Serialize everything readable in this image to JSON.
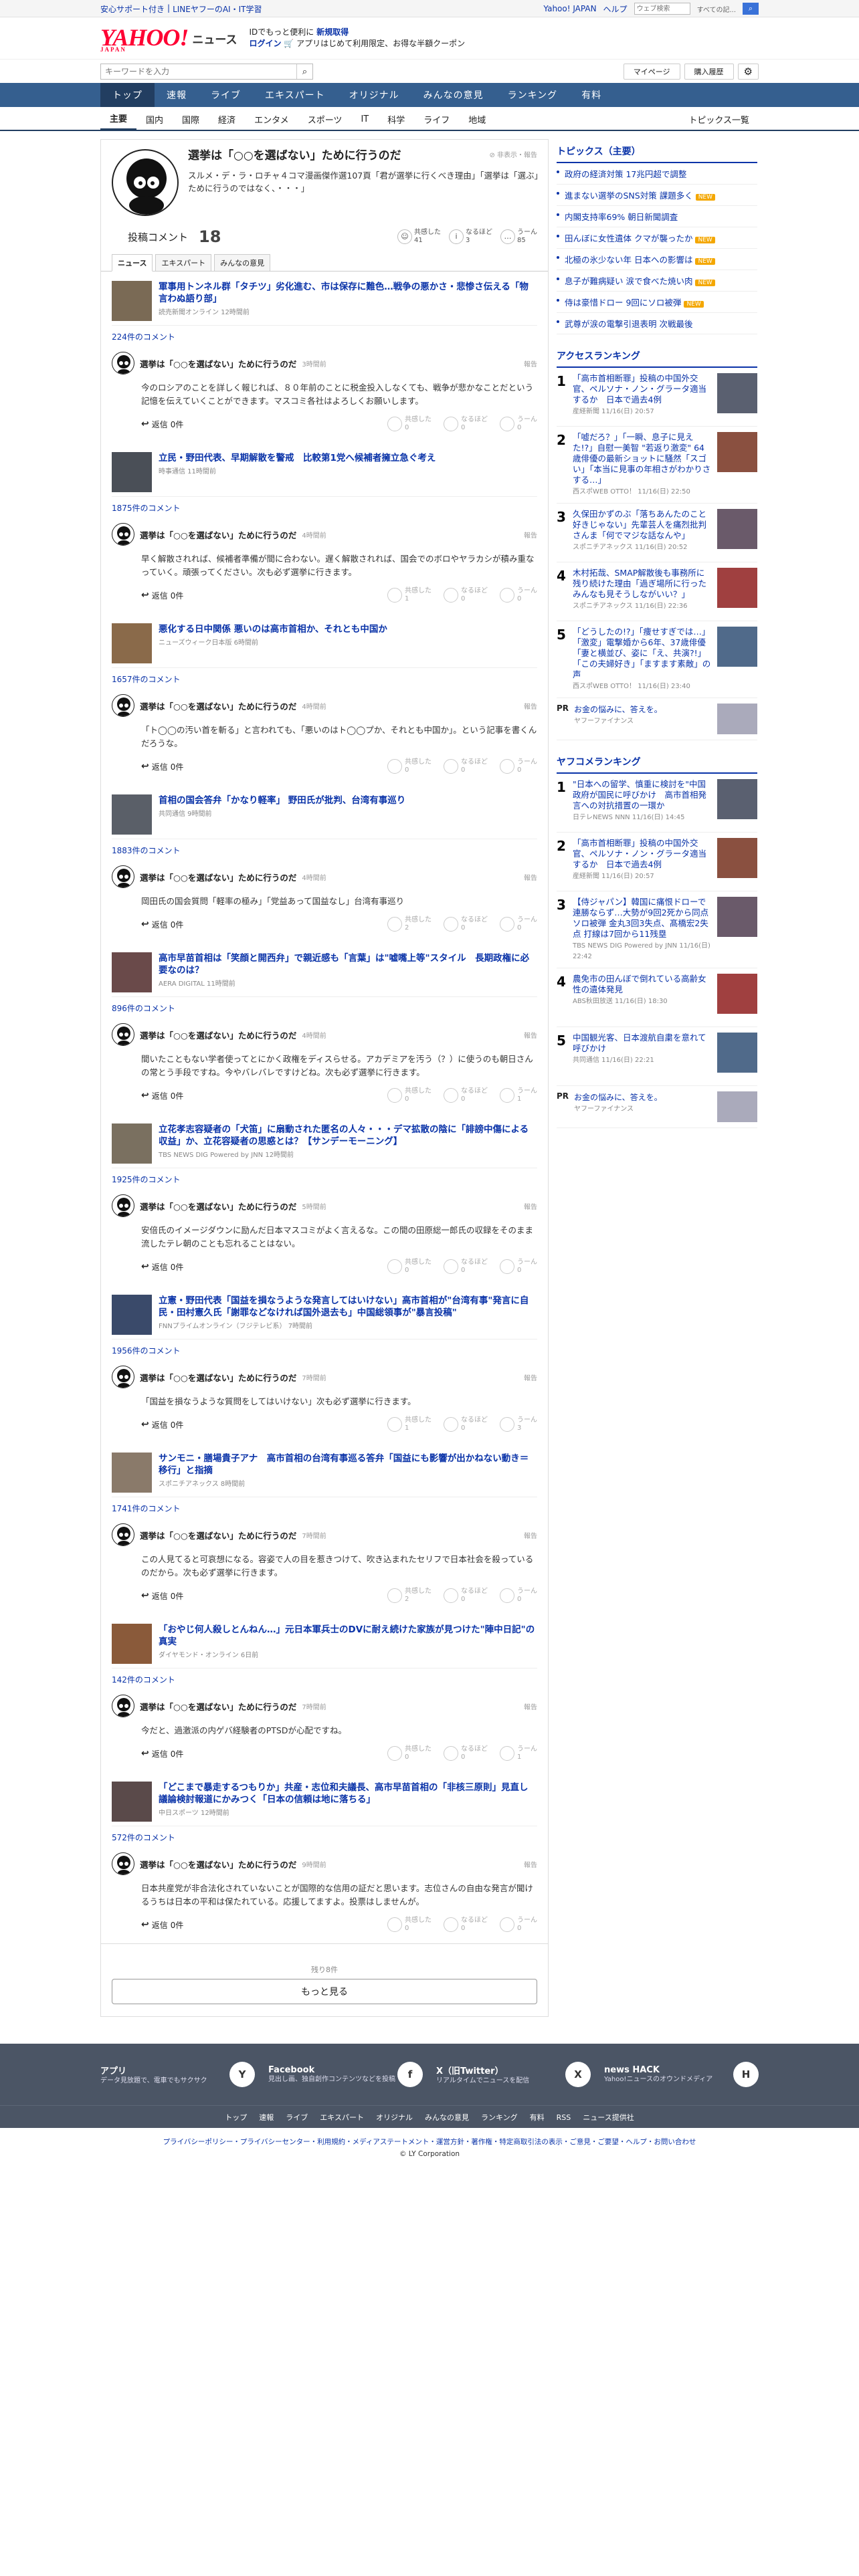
{
  "topbar": {
    "left": [
      "安心サポート付き",
      "LINEヤフーのAI・IT学習"
    ],
    "yahoo_japan": "Yahoo! JAPAN",
    "help": "ヘルプ",
    "search_placeholder": "ウェブ検索",
    "search_value": "すべての記..."
  },
  "header": {
    "logo": "YAHOO!",
    "logo_sub": "JAPAN",
    "section": "ニュース",
    "promo_line1": "IDでもっと便利に",
    "promo_link1": "新規取得",
    "promo_login": "ログイン",
    "promo_line2": "アプリはじめて利用限定、お得な半額クーポン"
  },
  "search": {
    "placeholder": "キーワードを入力",
    "mypage": "マイページ",
    "purchase": "購入履歴"
  },
  "gnav": [
    "トップ",
    "速報",
    "ライブ",
    "エキスパート",
    "オリジナル",
    "みんなの意見",
    "ランキング",
    "有料"
  ],
  "subnav": [
    "主要",
    "国内",
    "国際",
    "経済",
    "エンタメ",
    "スポーツ",
    "IT",
    "科学",
    "ライフ",
    "地域"
  ],
  "subnav_all": "トピックス一覧",
  "article": {
    "title": "選挙は「○○を選ばない」ために行うのだ",
    "text": "スルメ・デ・ラ・ロチャ４コマ漫画傑作選107頁「君が選挙に行くべき理由」「選挙は「選ぶ」ために行うのではなく、・・・」",
    "meta": "非表示・報告"
  },
  "stats": {
    "label": "投稿コメント",
    "count": "18",
    "reactions": [
      {
        "label": "共感した",
        "count": "41"
      },
      {
        "label": "なるほど",
        "count": "3"
      },
      {
        "label": "うーん",
        "count": "85"
      }
    ]
  },
  "tabs": [
    "ニュース",
    "エキスパート",
    "みんなの意見"
  ],
  "entries": [
    {
      "title": "軍事用トンネル群「タチツ」劣化進む、市は保存に難色…戦争の悪かさ・悲惨さ伝える「物言わぬ語り部」",
      "src": "読売新聞オンライン 12時間前",
      "count": "224件のコメント",
      "ctitle": "選挙は「○○を選ばない」ために行うのだ",
      "time": "3時間前",
      "text": "今のロシアのことを詳しく報じれば、８０年前のことに税金投入しなくても、戦争が悲かなことだという記憶を伝えていくことができます。マスコミ各社はよろしくお願いします。",
      "votes": [
        "0",
        "0",
        "0"
      ]
    },
    {
      "title": "立民・野田代表、早期解散を警戒　比較第1党へ候補者擁立急ぐ考え",
      "src": "時事通信 11時間前",
      "count": "1875件のコメント",
      "ctitle": "選挙は「○○を選ばない」ために行うのだ",
      "time": "4時間前",
      "text": "早く解散されれば、候補者準備が間に合わない。遅く解散されれば、国会でのボロやヤラカシが積み重なっていく。頑張ってください。次も必ず選挙に行きます。",
      "votes": [
        "1",
        "0",
        "0"
      ]
    },
    {
      "title": "悪化する日中関係 悪いのは高市首相か、それとも中国か",
      "src": "ニューズウィーク日本版 6時間前",
      "count": "1657件のコメント",
      "ctitle": "選挙は「○○を選ばない」ために行うのだ",
      "time": "4時間前",
      "text": "「ト◯◯の汚い首を斬る」と言われても、「悪いのはト◯◯プか、それとも中国か」。という記事を書くんだろうな。",
      "votes": [
        "0",
        "0",
        "0"
      ]
    },
    {
      "title": "首相の国会答弁「かなり軽率」 野田氏が批判、台湾有事巡り",
      "src": "共同通信 9時間前",
      "count": "1883件のコメント",
      "ctitle": "選挙は「○○を選ばない」ために行うのだ",
      "time": "4時間前",
      "text": "岡田氏の国会質問「軽率の極み」「党益あって国益なし」台湾有事巡り",
      "votes": [
        "2",
        "0",
        "0"
      ]
    },
    {
      "title": "高市早苗首相は「笑顔と開西弁」で親近感も「言葉」は\"嘘嘴上等\"スタイル　長期政権に必要なのは？",
      "src": "AERA DIGITAL 11時間前",
      "count": "896件のコメント",
      "ctitle": "選挙は「○○を選ばない」ために行うのだ",
      "time": "4時間前",
      "text": "間いたこともない学者使ってとにかく政権をディスらせる。アカデミアを汚う（？）に使うのも朝日さんの常とう手段ですね。今やバレバレですけどね。次も必ず選挙に行きます。",
      "votes": [
        "0",
        "0",
        "1"
      ]
    },
    {
      "title": "立花孝志容疑者の「犬笛」に扇動された匿名の人々・・・デマ拡散の陰に「誹謗中傷による収益」か、立花容疑者の思惑とは？【サンデーモーニング】",
      "src": "TBS NEWS DIG Powered by JNN 12時間前",
      "count": "1925件のコメント",
      "ctitle": "選挙は「○○を選ばない」ために行うのだ",
      "time": "5時間前",
      "text": "安倍氏のイメージダウンに励んだ日本マスコミがよく言えるな。この間の田原総一郎氏の収録をそのまま流したテレ朝のことも忘れることはない。",
      "votes": [
        "0",
        "0",
        "0"
      ]
    },
    {
      "title": "立憲・野田代表「国益を損なうような発言してはいけない」高市首相が\"台湾有事\"発言に自民・田村憲久氏「謝罪などなければ国外退去も」中国総領事が\"暴言投稿\"",
      "src": "FNNプライムオンライン（フジテレビ系） 7時間前",
      "count": "1956件のコメント",
      "ctitle": "選挙は「○○を選ばない」ために行うのだ",
      "time": "7時間前",
      "text": "「国益を損なうような質問をしてはいけない」次も必ず選挙に行きます。",
      "votes": [
        "1",
        "0",
        "3"
      ]
    },
    {
      "title": "サンモニ・膳場貴子アナ　高市首相の台湾有事巡る答弁「国益にも影響が出かねない動き＝移行」と指摘",
      "src": "スポニチアネックス 8時間前",
      "count": "1741件のコメント",
      "ctitle": "選挙は「○○を選ばない」ために行うのだ",
      "time": "7時間前",
      "text": "この人見てると可哀想になる。容姿で人の目を惹きつけて、吹き込まれたセリフで日本社会を殺っているのだから。次も必ず選挙に行きます。",
      "votes": [
        "2",
        "0",
        "0"
      ]
    },
    {
      "title": "「おやじ何人殺しとんねん…」元日本軍兵士のDVに耐え続けた家族が見つけた\"陣中日記\"の真実",
      "src": "ダイヤモンド・オンライン 6日前",
      "count": "142件のコメント",
      "ctitle": "選挙は「○○を選ばない」ために行うのだ",
      "time": "7時間前",
      "text": "今だと、過激派の内ゲバ経験者のPTSDが心配ですね。",
      "votes": [
        "0",
        "0",
        "1"
      ]
    },
    {
      "title": "「どこまで暴走するつもりか」共産・志位和夫議長、高市早苗首相の「非核三原則」見直し議論検討報道にかみつく「日本の信頼は地に落ちる」",
      "src": "中日スポーツ 12時間前",
      "count": "572件のコメント",
      "ctitle": "選挙は「○○を選ばない」ために行うのだ",
      "time": "9時間前",
      "text": "日本共産党が非合法化されていないことが国際的な信用の証だと思います。志位さんの自由な発言が聞けるうちは日本の平和は保たれている。応援してますよ。投票はしませんが。",
      "votes": [
        "0",
        "0",
        "0"
      ]
    }
  ],
  "labels": {
    "reply": "返信",
    "reply_count": "0件",
    "report": "報告",
    "vote_labels": [
      "共感した",
      "なるほど",
      "うーん"
    ],
    "rest": "残り8件",
    "more": "もっと見る"
  },
  "side": {
    "topics_title": "トピックス（主要）",
    "topics": [
      {
        "text": "政府の経済対策 17兆円超で調整",
        "badge": ""
      },
      {
        "text": "進まない選挙のSNS対策 課題多く",
        "badge": "NEW"
      },
      {
        "text": "内閣支持率69% 朝日新聞調査",
        "badge": ""
      },
      {
        "text": "田んぼに女性遺体 クマが襲ったか",
        "badge": "NEW"
      },
      {
        "text": "北極の氷少ない年 日本への影響は",
        "badge": "NEW"
      },
      {
        "text": "息子が難病疑い 涙で食べた焼い肉",
        "badge": "NEW"
      },
      {
        "text": "侍は豪惜ドロー 9回にソロ被弾",
        "badge": "NEW"
      },
      {
        "text": "武尊が涙の電撃引退表明 次戦最後",
        "badge": ""
      }
    ],
    "access_title": "アクセスランキング",
    "access": [
      {
        "n": "1",
        "text": "「高市首相断罪」投稿の中国外交官、ペルソナ・ノン・グラータ適当するか　日本で過去4例",
        "src": "産経新聞 11/16(日) 20:57"
      },
      {
        "n": "2",
        "text": "「嘘だろ？」「一瞬、息子に見えた!?」自慰一美智 \"若返り激変\" 64歳俳優の最新ショットに騒然「スゴい」「本当に見事の年相さがわかりさする…」",
        "src": "西スポWEB OTTO！ 11/16(日) 22:50"
      },
      {
        "n": "3",
        "text": "久保田かずのぶ「落ちあんたのこと好きじゃない」先輩芸人を痛烈批判　さんま「何でマジな話なんや」",
        "src": "スポニチアネックス 11/16(日) 20:52"
      },
      {
        "n": "4",
        "text": "木村拓哉、SMAP解散後も事務所に残り続けた理由「過ぎ場所に行ったみんなも見そうしながいい？」",
        "src": "スポニチアネックス 11/16(日) 22:36"
      },
      {
        "n": "5",
        "text": "「どうしたの!?」「痩せすぎでは…」「激変」電撃婚から6年、37歳俳優「妻と横並び、姿に「え、共演?!」「この夫婦好き」「ますます素敵」の声",
        "src": "西スポWEB OTTO！ 11/16(日) 23:40"
      }
    ],
    "pr1": {
      "text": "お金の悩みに、答えを。",
      "src": "ヤフーファイナンス"
    },
    "yahoo_title": "ヤフコメランキング",
    "yahoo": [
      {
        "n": "1",
        "text": "\"日本への留学、慎重に検討を\"中国政府が国民に呼びかけ　高市首相発言への対抗措置の一環か",
        "src": "日テレNEWS NNN 11/16(日) 14:45"
      },
      {
        "n": "2",
        "text": "「高市首相断罪」投稿の中国外交官、ペルソナ・ノン・グラータ適当するか　日本で過去4例",
        "src": "産経新聞 11/16(日) 20:57"
      },
      {
        "n": "3",
        "text": "【侍ジャパン】韓国に痛恨ドローで連勝ならず…大勢が9回2死から同点ソロ被弾 金丸3回3失点、髙橋宏2失点 打線は7回から11残塁",
        "src": "TBS NEWS DIG Powered by JNN 11/16(日) 22:42"
      },
      {
        "n": "4",
        "text": "農免市の田んぼで倒れている高齢女性の遺体発見",
        "src": "ABS秋田放送 11/16(日) 18:30"
      },
      {
        "n": "5",
        "text": "中国観光客、日本渡航自粛を意れて呼びかけ",
        "src": "共同通信 11/16(日) 22:21"
      }
    ],
    "pr2": {
      "text": "お金の悩みに、答えを。",
      "src": "ヤフーファイナンス"
    }
  },
  "footer": {
    "cols": [
      {
        "t": "アプリ",
        "d": "データ見放題で、電車でもサクサク",
        "icon": "Y"
      },
      {
        "t": "Facebook",
        "d": "見出し画、独自創作コンテンツなどを投稿",
        "icon": "f"
      },
      {
        "t": "X（旧Twitter）",
        "d": "リアルタイムでニュースを配信",
        "icon": "X"
      },
      {
        "t": "news HACK",
        "d": "Yahoo!ニュースのオウンドメディア",
        "icon": "H"
      }
    ],
    "nav": [
      "トップ",
      "速報",
      "ライブ",
      "エキスパート",
      "オリジナル",
      "みんなの意見",
      "ランキング",
      "有料",
      "RSS",
      "ニュース提供社"
    ],
    "legal": "プライバシーポリシー・プライバシーセンター・利用規約・メディアステートメント・運営方針・著作権・特定商取引法の表示・ご意見・ご要望・ヘルプ・お問い合わせ",
    "copyright": "© LY Corporation"
  }
}
